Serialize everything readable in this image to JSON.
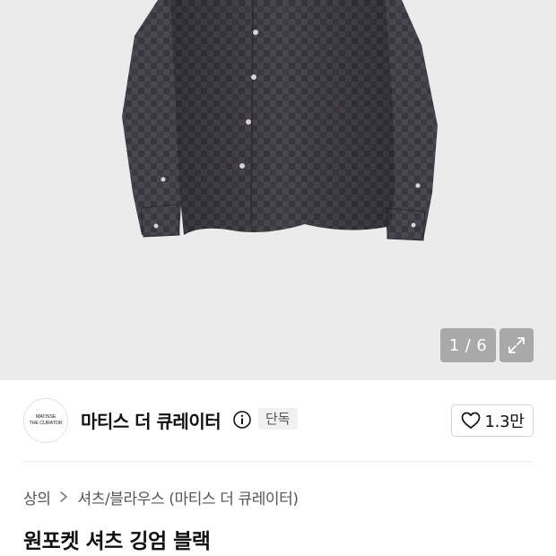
{
  "gallery": {
    "current": "1",
    "separator": "/",
    "total": "6",
    "expand_icon": "expand-arrows-icon",
    "shirt_colors": {
      "base": "#3b3b40",
      "check": "#5a5256",
      "button": "#d8d4d0"
    }
  },
  "brand": {
    "logo_line1": "MATISSE",
    "logo_line2": "THE CURATOR",
    "name": "마티스 더 큐레이터",
    "info_icon": "info-icon",
    "exclusive_badge": "단독"
  },
  "like": {
    "icon": "heart-icon",
    "count": "1.3만"
  },
  "breadcrumb": {
    "level1": "상의",
    "level2": "셔츠/블라우스 (마티스 더 큐레이터)"
  },
  "product": {
    "title": "원포켓 셔츠 깅엄 블랙"
  }
}
